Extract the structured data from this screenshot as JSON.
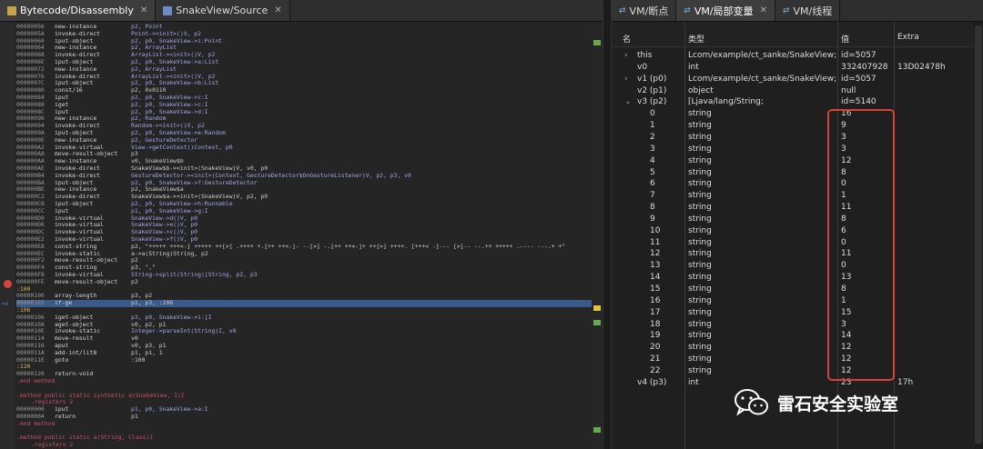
{
  "left_tabs": [
    {
      "label": "Bytecode/Disassembly",
      "active": true
    },
    {
      "label": "SnakeView/Source",
      "active": false
    }
  ],
  "code_lines": [
    {
      "addr": "00000056",
      "op": "new-instance",
      "args": "p2, Point"
    },
    {
      "addr": "0000005A",
      "op": "invoke-direct",
      "args": "Point-><init>()V, p2"
    },
    {
      "addr": "00000060",
      "op": "iput-object",
      "args": "p2, p0, SnakeView->i:Point"
    },
    {
      "addr": "00000064",
      "op": "new-instance",
      "args": "p2, ArrayList"
    },
    {
      "addr": "00000068",
      "op": "invoke-direct",
      "args": "ArrayList-><init>()V, p2"
    },
    {
      "addr": "0000006E",
      "op": "iput-object",
      "args": "p2, p0, SnakeView->a:List"
    },
    {
      "addr": "00000072",
      "op": "new-instance",
      "args": "p2, ArrayList"
    },
    {
      "addr": "00000076",
      "op": "invoke-direct",
      "args": "ArrayList-><init>()V, p2"
    },
    {
      "addr": "0000007C",
      "op": "iput-object",
      "args": "p2, p0, SnakeView->b:List"
    },
    {
      "addr": "00000080",
      "op": "const/16",
      "args": "p2, 0x0110"
    },
    {
      "addr": "00000084",
      "op": "iput",
      "args": "p2, p0, SnakeView->c:I"
    },
    {
      "addr": "00000088",
      "op": "iget",
      "args": "p2, p0, SnakeView->c:I"
    },
    {
      "addr": "0000008C",
      "op": "iput",
      "args": "p2, p0, SnakeView->d:I"
    },
    {
      "addr": "00000090",
      "op": "new-instance",
      "args": "p2, Random"
    },
    {
      "addr": "00000094",
      "op": "invoke-direct",
      "args": "Random-><init>()V, p2"
    },
    {
      "addr": "0000009A",
      "op": "iput-object",
      "args": "p2, p0, SnakeView->e:Random"
    },
    {
      "addr": "0000009E",
      "op": "new-instance",
      "args": "p2, GestureDetector"
    },
    {
      "addr": "000000A2",
      "op": "invoke-virtual",
      "args": "View->getContext()Context, p0"
    },
    {
      "addr": "000000A8",
      "op": "move-result-object",
      "args": "p3"
    },
    {
      "addr": "000000AA",
      "op": "new-instance",
      "args": "v0, SnakeView$b"
    },
    {
      "addr": "000000AE",
      "op": "invoke-direct",
      "args": "SnakeView$b-><init>(SnakeView)V, v0, p0"
    },
    {
      "addr": "000000B4",
      "op": "invoke-direct",
      "args": "GestureDetector-><init>(Context, GestureDetector$OnGestureListener)V, p2, p3, v0"
    },
    {
      "addr": "000000BA",
      "op": "iput-object",
      "args": "p2, p0, SnakeView->f:GestureDetector"
    },
    {
      "addr": "000000BE",
      "op": "new-instance",
      "args": "p2, SnakeView$a"
    },
    {
      "addr": "000000C2",
      "op": "invoke-direct",
      "args": "SnakeView$a-><init>(SnakeView)V, p2, p0"
    },
    {
      "addr": "000000C8",
      "op": "iput-object",
      "args": "p2, p0, SnakeView->h:Runnable"
    },
    {
      "addr": "000000CC",
      "op": "iput",
      "args": "p1, p0, SnakeView->g:I"
    },
    {
      "addr": "000000D0",
      "op": "invoke-virtual",
      "args": "SnakeView->d()V, p0"
    },
    {
      "addr": "000000D6",
      "op": "invoke-virtual",
      "args": "SnakeView->e()V, p0"
    },
    {
      "addr": "000000DC",
      "op": "invoke-virtual",
      "args": "SnakeView->c()V, p0"
    },
    {
      "addr": "000000E2",
      "op": "invoke-virtual",
      "args": "SnakeView->f()V, p0"
    },
    {
      "addr": "000000E8",
      "op": "const-string",
      "args": "p2, \"+++++ +++<-] +++++ ++[>] .++++ +.[++ ++<-]- --[>] -.[++ ++<-]+ ++[>] ++++. [+++< -]--- [>]-- --.++ +++++ .---- ---.+ +\""
    },
    {
      "addr": "000000EC",
      "op": "invoke-static",
      "args": "a->a(String)String, p2"
    },
    {
      "addr": "000000F2",
      "op": "move-result-object",
      "args": "p2"
    },
    {
      "addr": "000000F4",
      "op": "const-string",
      "args": "p3, \",\""
    },
    {
      "addr": "000000F8",
      "op": "invoke-virtual",
      "args": "String->split(String)[String, p2, p3"
    },
    {
      "addr": "000000FE",
      "op": "move-result-object",
      "args": "p2"
    },
    {
      "label": ":100"
    },
    {
      "addr": "00000100",
      "op": "array-length",
      "args": "p3, p2"
    },
    {
      "addr": "00000102",
      "op": "if-ge",
      "args": "p1, p3, :106",
      "highlight": true
    },
    {
      "label": ":106"
    },
    {
      "addr": "00000106",
      "op": "iget-object",
      "args": "p3, p0, SnakeView->i:[I"
    },
    {
      "addr": "0000010A",
      "op": "aget-object",
      "args": "v0, p2, p1"
    },
    {
      "addr": "0000010E",
      "op": "invoke-static",
      "args": "Integer->parseInt(String)I, v0"
    },
    {
      "addr": "00000114",
      "op": "move-result",
      "args": "v0"
    },
    {
      "addr": "00000116",
      "op": "aput",
      "args": "v0, p3, p1"
    },
    {
      "addr": "0000011A",
      "op": "add-int/lit8",
      "args": "p1, p1, 1"
    },
    {
      "addr": "0000011E",
      "op": "goto",
      "args": ":100"
    },
    {
      "label": ":120"
    },
    {
      "addr": "00000120",
      "op": "return-void",
      "args": ""
    },
    {
      "directive": ".end method"
    },
    {
      "blank": true
    },
    {
      "directive": ".method public static synthetic a(SnakeView, I)I"
    },
    {
      "register": ".registers 2"
    },
    {
      "addr": "00000000",
      "op": "iput",
      "args": "p1, p0, SnakeView->a:I"
    },
    {
      "addr": "00000004",
      "op": "return",
      "args": "p1"
    },
    {
      "directive": ".end method"
    },
    {
      "blank": true
    },
    {
      "directive": ".method public static a(String, Class)I"
    },
    {
      "register": ".registers 2"
    }
  ],
  "right_tabs": [
    {
      "label": "VM/断点",
      "active": false
    },
    {
      "label": "VM/局部变量",
      "active": true
    },
    {
      "label": "VM/线程",
      "active": false
    }
  ],
  "vm_headers": {
    "name": "名",
    "type": "类型",
    "value": "值",
    "extra": "Extra"
  },
  "vm_rows": [
    {
      "expander": "›",
      "name": "this",
      "type": "Lcom/example/ct_sanke/SnakeView;",
      "value": "id=5057",
      "extra": ""
    },
    {
      "expander": "",
      "name": "v0",
      "type": "int",
      "value": "332407928",
      "extra": "13D02478h"
    },
    {
      "expander": "›",
      "name": "v1 (p0)",
      "type": "Lcom/example/ct_sanke/SnakeView;",
      "value": "id=5057",
      "extra": ""
    },
    {
      "expander": "",
      "name": "v2 (p1)",
      "type": "object",
      "value": "null",
      "extra": ""
    },
    {
      "expander": "⌄",
      "name": "v3 (p2)",
      "type": "[Ljava/lang/String;",
      "value": "id=5140",
      "extra": ""
    },
    {
      "expander": "",
      "name": "0",
      "type": "string",
      "value": "16",
      "extra": "",
      "indent": true
    },
    {
      "expander": "",
      "name": "1",
      "type": "string",
      "value": "9",
      "extra": "",
      "indent": true
    },
    {
      "expander": "",
      "name": "2",
      "type": "string",
      "value": "3",
      "extra": "",
      "indent": true
    },
    {
      "expander": "",
      "name": "3",
      "type": "string",
      "value": "3",
      "extra": "",
      "indent": true
    },
    {
      "expander": "",
      "name": "4",
      "type": "string",
      "value": "12",
      "extra": "",
      "indent": true
    },
    {
      "expander": "",
      "name": "5",
      "type": "string",
      "value": "8",
      "extra": "",
      "indent": true
    },
    {
      "expander": "",
      "name": "6",
      "type": "string",
      "value": "0",
      "extra": "",
      "indent": true
    },
    {
      "expander": "",
      "name": "7",
      "type": "string",
      "value": "1",
      "extra": "",
      "indent": true
    },
    {
      "expander": "",
      "name": "8",
      "type": "string",
      "value": "11",
      "extra": "",
      "indent": true
    },
    {
      "expander": "",
      "name": "9",
      "type": "string",
      "value": "8",
      "extra": "",
      "indent": true
    },
    {
      "expander": "",
      "name": "10",
      "type": "string",
      "value": "6",
      "extra": "",
      "indent": true
    },
    {
      "expander": "",
      "name": "11",
      "type": "string",
      "value": "0",
      "extra": "",
      "indent": true
    },
    {
      "expander": "",
      "name": "12",
      "type": "string",
      "value": "11",
      "extra": "",
      "indent": true
    },
    {
      "expander": "",
      "name": "13",
      "type": "string",
      "value": "0",
      "extra": "",
      "indent": true
    },
    {
      "expander": "",
      "name": "14",
      "type": "string",
      "value": "13",
      "extra": "",
      "indent": true
    },
    {
      "expander": "",
      "name": "15",
      "type": "string",
      "value": "8",
      "extra": "",
      "indent": true
    },
    {
      "expander": "",
      "name": "16",
      "type": "string",
      "value": "1",
      "extra": "",
      "indent": true
    },
    {
      "expander": "",
      "name": "17",
      "type": "string",
      "value": "15",
      "extra": "",
      "indent": true
    },
    {
      "expander": "",
      "name": "18",
      "type": "string",
      "value": "3",
      "extra": "",
      "indent": true
    },
    {
      "expander": "",
      "name": "19",
      "type": "string",
      "value": "14",
      "extra": "",
      "indent": true
    },
    {
      "expander": "",
      "name": "20",
      "type": "string",
      "value": "12",
      "extra": "",
      "indent": true
    },
    {
      "expander": "",
      "name": "21",
      "type": "string",
      "value": "12",
      "extra": "",
      "indent": true
    },
    {
      "expander": "",
      "name": "22",
      "type": "string",
      "value": "12",
      "extra": "",
      "indent": true
    },
    {
      "expander": "",
      "name": "v4 (p3)",
      "type": "int",
      "value": "23",
      "extra": "17h"
    }
  ],
  "watermark": {
    "title": "雷石安全实验室",
    "icon": "wechat-icon"
  },
  "colors": {
    "highlight_row": "#3a5b8a",
    "red_box": "#d8413a",
    "breakpoint": "#d8443a",
    "accent_blue": "#3d8ee0"
  }
}
